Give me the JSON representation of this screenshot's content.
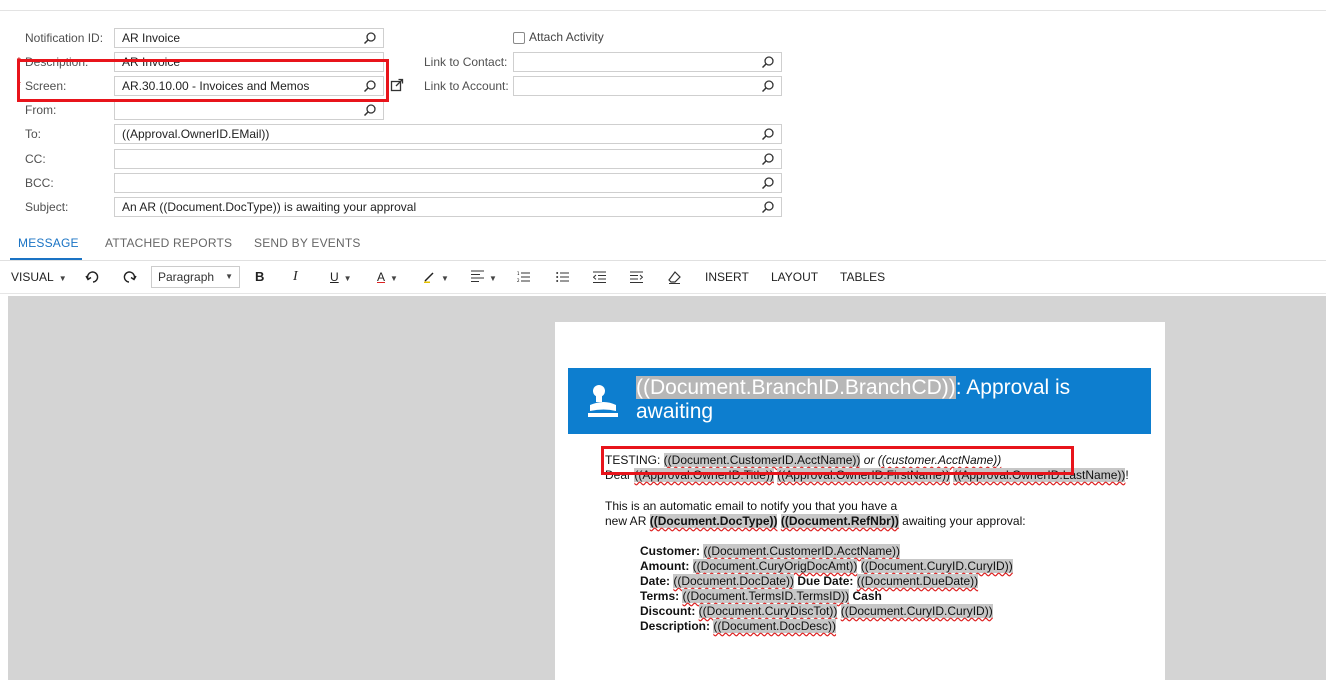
{
  "form": {
    "notification_id": {
      "label": "Notification ID:",
      "value": "AR Invoice"
    },
    "attach_activity": {
      "label": "Attach Activity",
      "checked": false
    },
    "description": {
      "label": "Description:",
      "value": "AR Invoice"
    },
    "link_to_contact": {
      "label": "Link to Contact:",
      "value": ""
    },
    "screen": {
      "label": "Screen:",
      "value": "AR.30.10.00 - Invoices and Memos"
    },
    "link_to_account": {
      "label": "Link to Account:",
      "value": ""
    },
    "from": {
      "label": "From:",
      "value": ""
    },
    "to": {
      "label": "To:",
      "value": "((Approval.OwnerID.EMail))"
    },
    "cc": {
      "label": "CC:",
      "value": ""
    },
    "bcc": {
      "label": "BCC:",
      "value": ""
    },
    "subject": {
      "label": "Subject:",
      "value": "An AR ((Document.DocType)) is awaiting your approval"
    }
  },
  "tabs": [
    {
      "label": "MESSAGE",
      "active": true
    },
    {
      "label": "ATTACHED REPORTS",
      "active": false
    },
    {
      "label": "SEND BY EVENTS",
      "active": false
    }
  ],
  "toolbar": {
    "visual": "VISUAL",
    "paragraph": "Paragraph",
    "bold": "B",
    "italic": "I",
    "underline": "U",
    "font_color": "A",
    "insert": "INSERT",
    "layout": "LAYOUT",
    "tables": "TABLES"
  },
  "email": {
    "banner_title_var": "((Document.BranchID.BranchCD))",
    "banner_title_rest_1": ": Approval is",
    "banner_title_rest_2": "awaiting",
    "testing_label": "TESTING: ",
    "testing_var": "((Document.CustomerID.AcctName))",
    "testing_or": " or ",
    "testing_alt": "((customer.AcctName))",
    "dear_label": "Dear ",
    "dear_var1": "((Approval.OwnerID.Title))",
    "dear_var2": "((Approval.OwnerID.FirstName))",
    "dear_var3": "((Approval.OwnerID.LastName))",
    "dear_end": "!",
    "intro_line1": "This is an automatic email to notify you that you have a",
    "intro_line2_pre": "new AR ",
    "intro_var1": "((Document.DocType))",
    "intro_var2": "((Document.RefNbr))",
    "intro_line2_post": " awaiting your approval:",
    "customer_label": "Customer: ",
    "customer_var": "((Document.CustomerID.AcctName))",
    "amount_label": "Amount: ",
    "amount_var1": "((Document.CuryOrigDocAmt))",
    "amount_var2": "((Document.CuryID.CuryID))",
    "date_label": "Date: ",
    "date_var": "((Document.DocDate))",
    "due_label": " Due Date: ",
    "due_var": "((Document.DueDate))",
    "terms_label": "Terms: ",
    "terms_var": "((Document.TermsID.TermsID))",
    "terms_post": " Cash",
    "discount_label": "Discount: ",
    "discount_var1": "((Document.CuryDiscTot))",
    "discount_var2": "((Document.CuryID.CuryID))",
    "description_label": "Description: ",
    "description_var": "((Document.DocDesc))"
  },
  "colors": {
    "accent": "#1a73c4",
    "banner": "#0d7ecf",
    "highlight_box": "#e8141b"
  }
}
